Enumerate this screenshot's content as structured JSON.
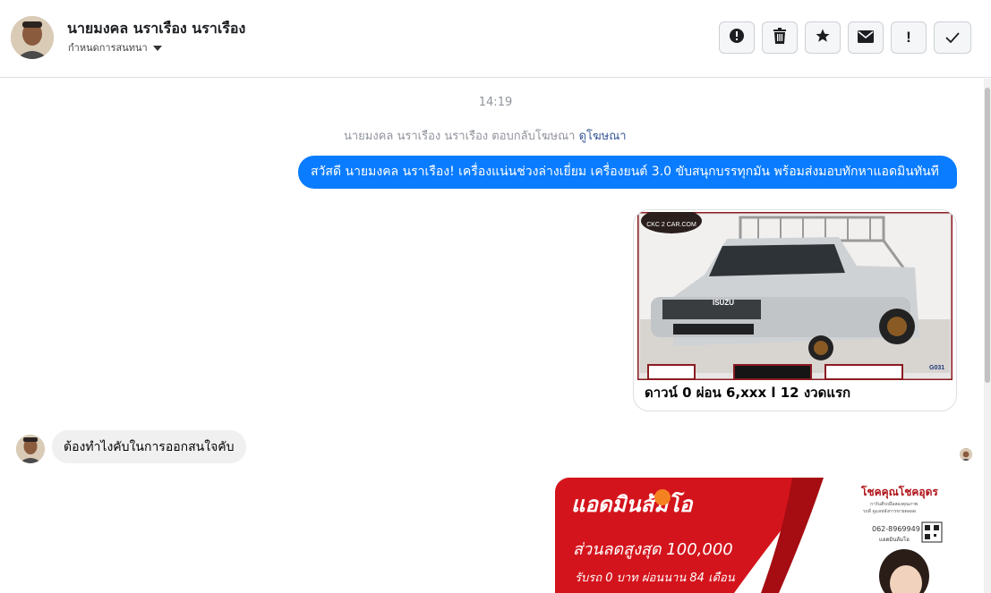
{
  "header": {
    "contact_name": "นายมงคล นราเรือง นราเรือง",
    "conversation_settings": "กำหนดการสนทนา",
    "toolbar": [
      {
        "icon": "alert-icon",
        "label": "!"
      },
      {
        "icon": "trash-icon",
        "label": ""
      },
      {
        "icon": "star-icon",
        "label": ""
      },
      {
        "icon": "mail-icon",
        "label": ""
      },
      {
        "icon": "exclamation-icon",
        "label": "!"
      },
      {
        "icon": "check-icon",
        "label": "✓"
      }
    ]
  },
  "thread": {
    "timestamp": "14:19",
    "reply_note": "นายมงคล นราเรือง นราเรือง ตอบกลับโฆษณา",
    "reply_link": "ดูโฆษณา",
    "outgoing_message": "สวัสดี นายมงคล นราเรือง! เครื่องแน่นช่วงล่างเยี่ยม  เครื่องยนต์ 3.0 ขับสนุกบรรทุกมัน พร้อมส่งมอบทักหาแอดมินทันที",
    "card": {
      "caption": "ดาวน์ 0 ผ่อน 6,xxx l 12 งวดแรก",
      "logo_text": "CKC 2 CAR.COM",
      "grille_text": "ISUZU",
      "code": "G031"
    },
    "incoming_message": "ต้องทำไงคับในการออกสนใจคับ",
    "ad": {
      "brand": "แอดมินส้มโอ",
      "discount": "ส่วนลดสูงสุด 100,000",
      "terms": "รับรถ 0 บาท ผ่อนนาน 84 เดือน",
      "right_title": "โชคคุณโชคอุดร",
      "right_sub1": "การันตีรถมือสองคุณภาพ",
      "right_sub2": "รถดี ดูแลหลังการขายตลอด",
      "phone": "062-8969949",
      "admin": "แอดมินส้มโอ"
    }
  },
  "colors": {
    "outgoing_bubble": "#0a7cff",
    "incoming_bubble": "#f1f0f0",
    "link": "#385898",
    "muted": "#90949c",
    "ad_red": "#d4141c"
  }
}
